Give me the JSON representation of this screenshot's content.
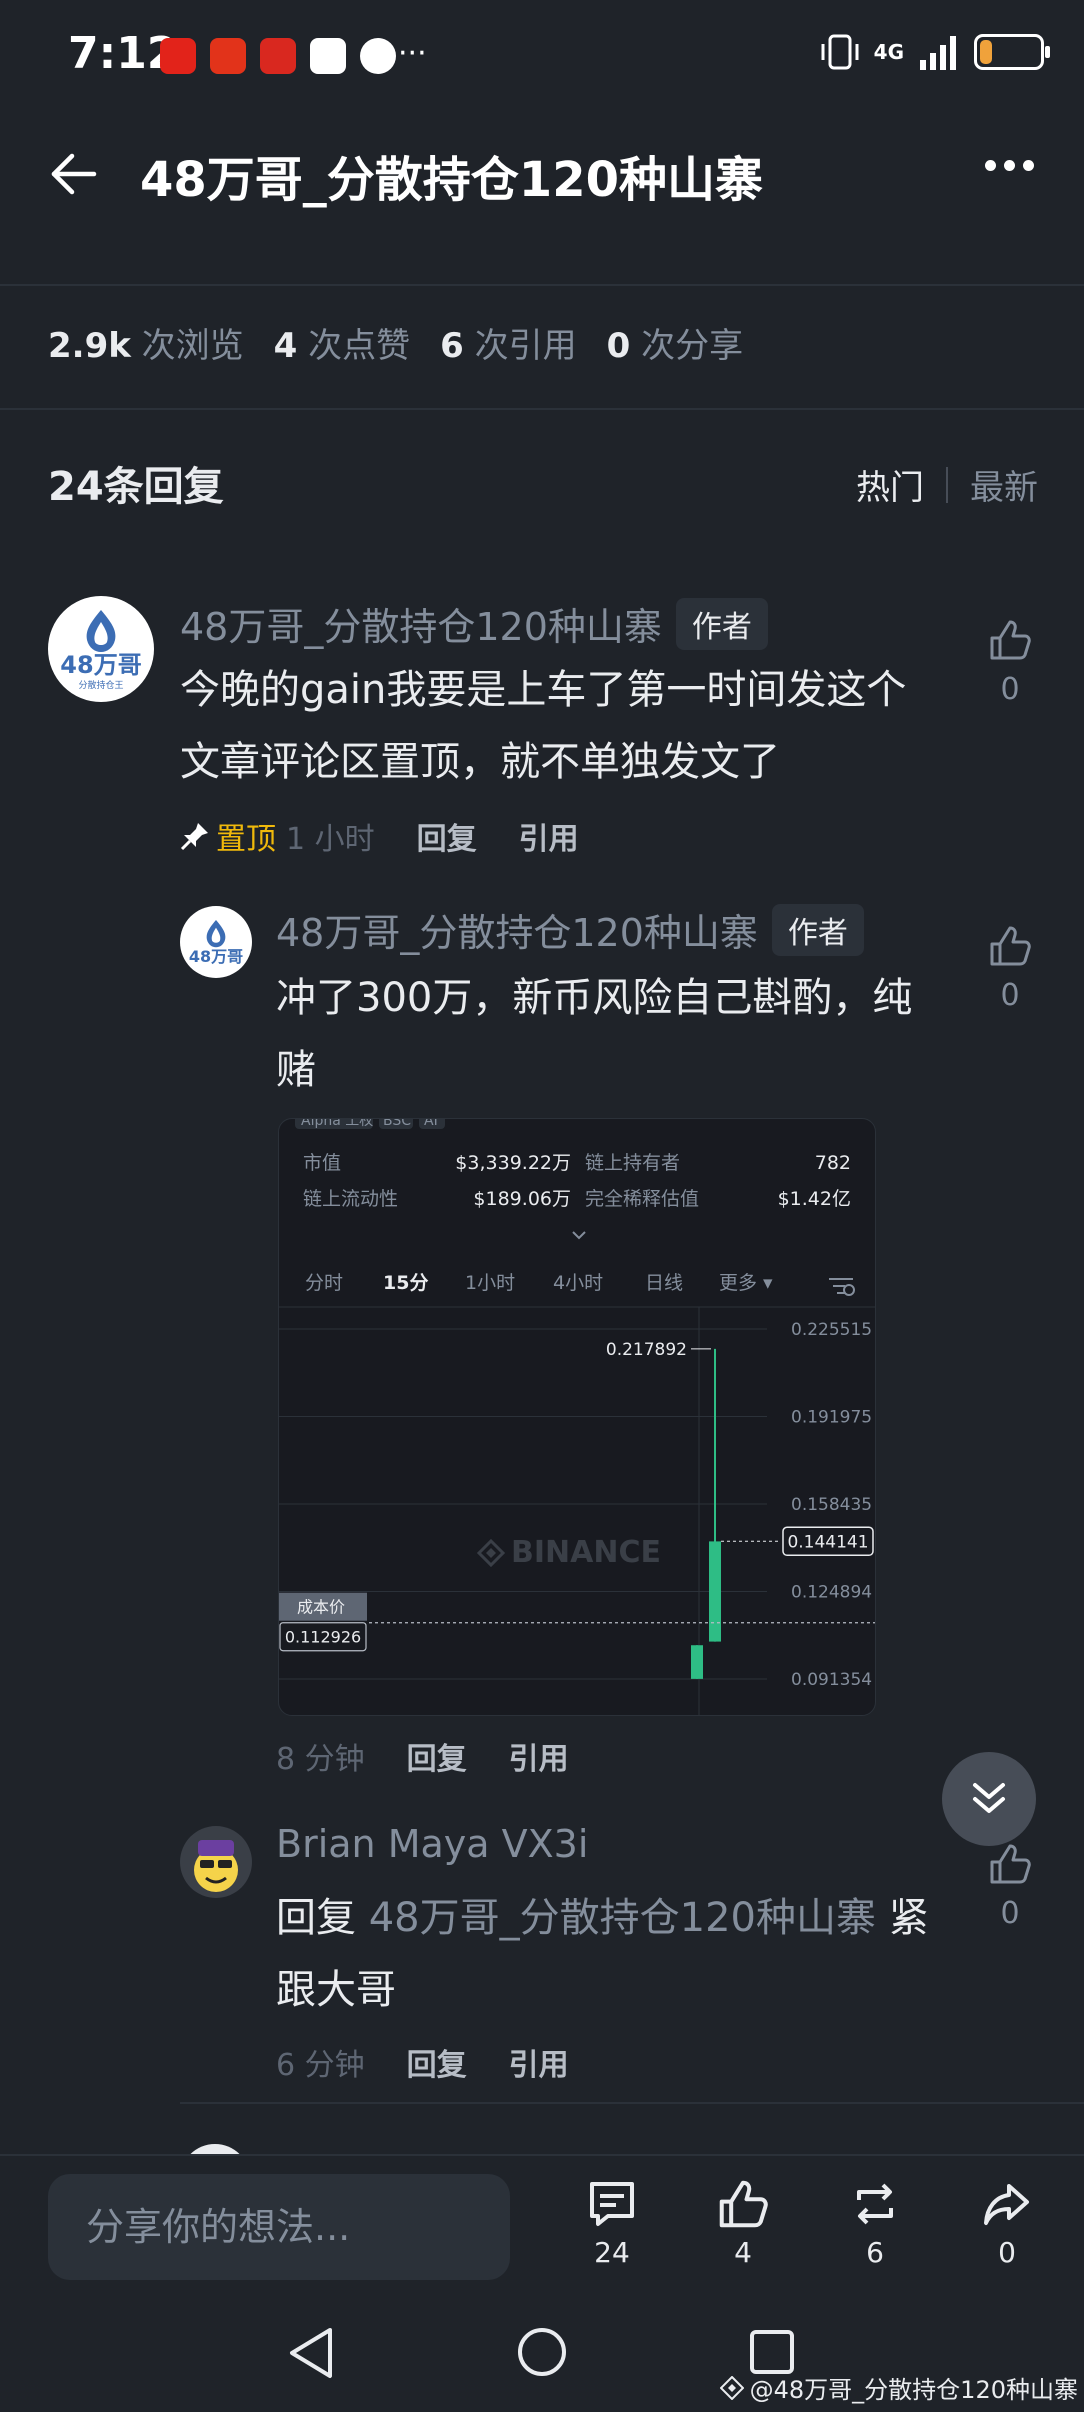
{
  "status_bar": {
    "time": "7:12",
    "more_indicator": "···",
    "network": "4G",
    "battery_level_percent": 20,
    "notification_icons": [
      "huawei-app-icon",
      "app-icon-2",
      "bank-app-icon",
      "app-icon-4",
      "qq-icon"
    ]
  },
  "header": {
    "title": "48万哥_分散持仓120种山寨",
    "back_icon": "arrow-left-icon",
    "menu_icon": "more-dots-icon"
  },
  "stats": [
    {
      "value": "2.9k",
      "label": "次浏览"
    },
    {
      "value": "4",
      "label": "次点赞"
    },
    {
      "value": "6",
      "label": "次引用"
    },
    {
      "value": "0",
      "label": "次分享"
    }
  ],
  "replies": {
    "count_label": "24条回复",
    "sort_hot": "热门",
    "sort_new": "最新"
  },
  "comments": [
    {
      "author": "48万哥_分散持仓120种山寨",
      "badge": "作者",
      "avatar_text": "48万哥",
      "avatar_subtext": "分散持仓王",
      "text_line1": "今晚的gain我要是上车了第一时间发这个",
      "text_line2": "文章评论区置顶，就不单独发文了",
      "pinned_label": "置顶",
      "time": "1 小时",
      "reply": "回复",
      "quote": "引用",
      "likes": "0"
    },
    {
      "author": "48万哥_分散持仓120种山寨",
      "badge": "作者",
      "avatar_text": "48万哥",
      "text_line1": "冲了300万，新币风险自己斟酌，纯",
      "text_line2": "赌",
      "time": "8 分钟",
      "reply": "回复",
      "quote": "引用",
      "likes": "0"
    },
    {
      "author": "Brian Maya VX3i",
      "reply_prefix": "回复",
      "reply_to": "48万哥_分散持仓120种山寨",
      "text_tail": "紧",
      "text_line2": "跟大哥",
      "time": "6 分钟",
      "reply": "回复",
      "quote": "引用",
      "likes": "0"
    }
  ],
  "embedded_chart": {
    "top_tags": [
      "Alpha 工权",
      "BSC",
      "AI"
    ],
    "market_cap_label": "市值",
    "market_cap_value": "$3,339.22万",
    "holders_label": "链上持有者",
    "holders_value": "782",
    "liquidity_label": "链上流动性",
    "liquidity_value": "$189.06万",
    "fdv_label": "完全稀释估值",
    "fdv_value": "$1.42亿",
    "timeframes": [
      "分时",
      "15分",
      "1小时",
      "4小时",
      "日线",
      "更多 ▾"
    ],
    "active_timeframe": "15分",
    "watermark": "BINANCE",
    "cost_label": "成本价",
    "cost_value": "0.112926",
    "high_label": "0.217892",
    "current_price": "0.144141",
    "up_color": "#2ebd85",
    "chart_data": {
      "type": "candlestick",
      "y_ticks": [
        "0.225515",
        "0.191975",
        "0.158435",
        "0.124894",
        "0.091354"
      ],
      "ylim": [
        0.091354,
        0.225515
      ],
      "cost_price": 0.112926,
      "current_price": 0.144141,
      "candles": [
        {
          "open": 0.0914,
          "close": 0.1043,
          "high": 0.1043,
          "low": 0.0914
        },
        {
          "open": 0.1057,
          "close": 0.1441,
          "high": 0.2179,
          "low": 0.1057
        }
      ]
    }
  },
  "bottom_bar": {
    "placeholder": "分享你的想法...",
    "comments": "24",
    "likes": "4",
    "reposts": "6",
    "shares": "0"
  },
  "watermark": "@48万哥_分散持仓120种山寨"
}
